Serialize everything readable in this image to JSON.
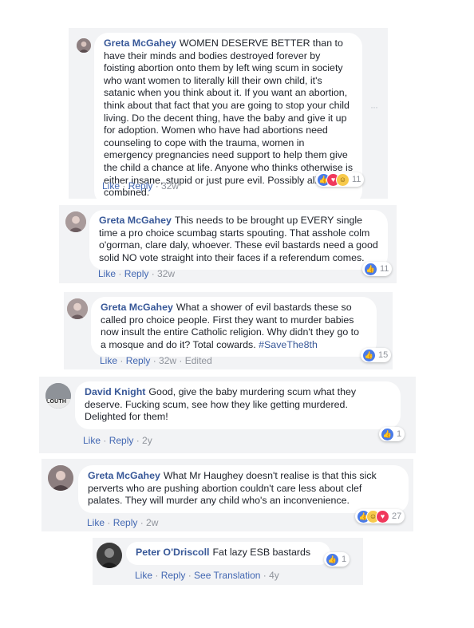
{
  "colors": {
    "link": "#385898",
    "action": "#4267b2",
    "meta": "#90949c",
    "panel": "#f2f3f5"
  },
  "comments": [
    {
      "author": "Greta McGahey",
      "text": "WOMEN DESERVE BETTER than to have their minds and bodies destroyed forever by foisting abortion onto them by left wing scum in society who want women to literally kill their own child, it's satanic when you think about it. If you want an abortion, think about that fact that you are going to stop your child living. Do the decent thing, have the baby and give it up for adoption. Women who have had abortions need counseling to cope with the trauma, women in emergency pregnancies need support to help them give the child a chance at life. Anyone who thinks otherwise is either insane, stupid or just pure evil. Possibly all three combined.",
      "actions": [
        "Like",
        "Reply"
      ],
      "time": "32w",
      "reactions": [
        "like-icon",
        "love-icon",
        "haha-icon"
      ],
      "count": "11",
      "more": "···"
    },
    {
      "author": "Greta McGahey",
      "text": "This needs to be brought up EVERY single time a pro choice scumbag starts spouting. That asshole colm o'gorman, clare daly, whoever. These evil bastards need a good solid NO vote straight into their faces if a referendum comes.",
      "actions": [
        "Like",
        "Reply"
      ],
      "time": "32w",
      "reactions": [
        "like-icon"
      ],
      "count": "11"
    },
    {
      "author": "Greta McGahey",
      "text": "What a shower of evil bastards these so called pro choice people. First they want to murder babies now insult the entire Catholic religion. Why didn't they go to a mosque and do it? Total cowards.",
      "hashtag": "#SaveThe8th",
      "actions": [
        "Like",
        "Reply"
      ],
      "time": "32w",
      "edited": "Edited",
      "reactions": [
        "like-icon"
      ],
      "count": "15"
    },
    {
      "author": "David Knight",
      "text": "Good, give the baby murdering scum what they deserve. Fucking scum, see how they like getting murdered. Delighted for them!",
      "actions": [
        "Like",
        "Reply"
      ],
      "time": "2y",
      "reactions": [
        "like-icon"
      ],
      "count": "1",
      "avatar_text": "LOUTH"
    },
    {
      "author": "Greta McGahey",
      "text": "What Mr Haughey doesn't realise is that this sick perverts who are pushing abortion couldn't care less about clef palates. They will murder any child who's an inconvenience.",
      "actions": [
        "Like",
        "Reply"
      ],
      "time": "2w",
      "reactions": [
        "like-icon",
        "haha-icon",
        "love-icon"
      ],
      "count": "27"
    },
    {
      "author": "Peter O'Driscoll",
      "text": "Fat lazy ESB bastards",
      "actions": [
        "Like",
        "Reply",
        "See Translation"
      ],
      "time": "4y",
      "reactions": [
        "like-icon"
      ],
      "count": "1"
    }
  ]
}
